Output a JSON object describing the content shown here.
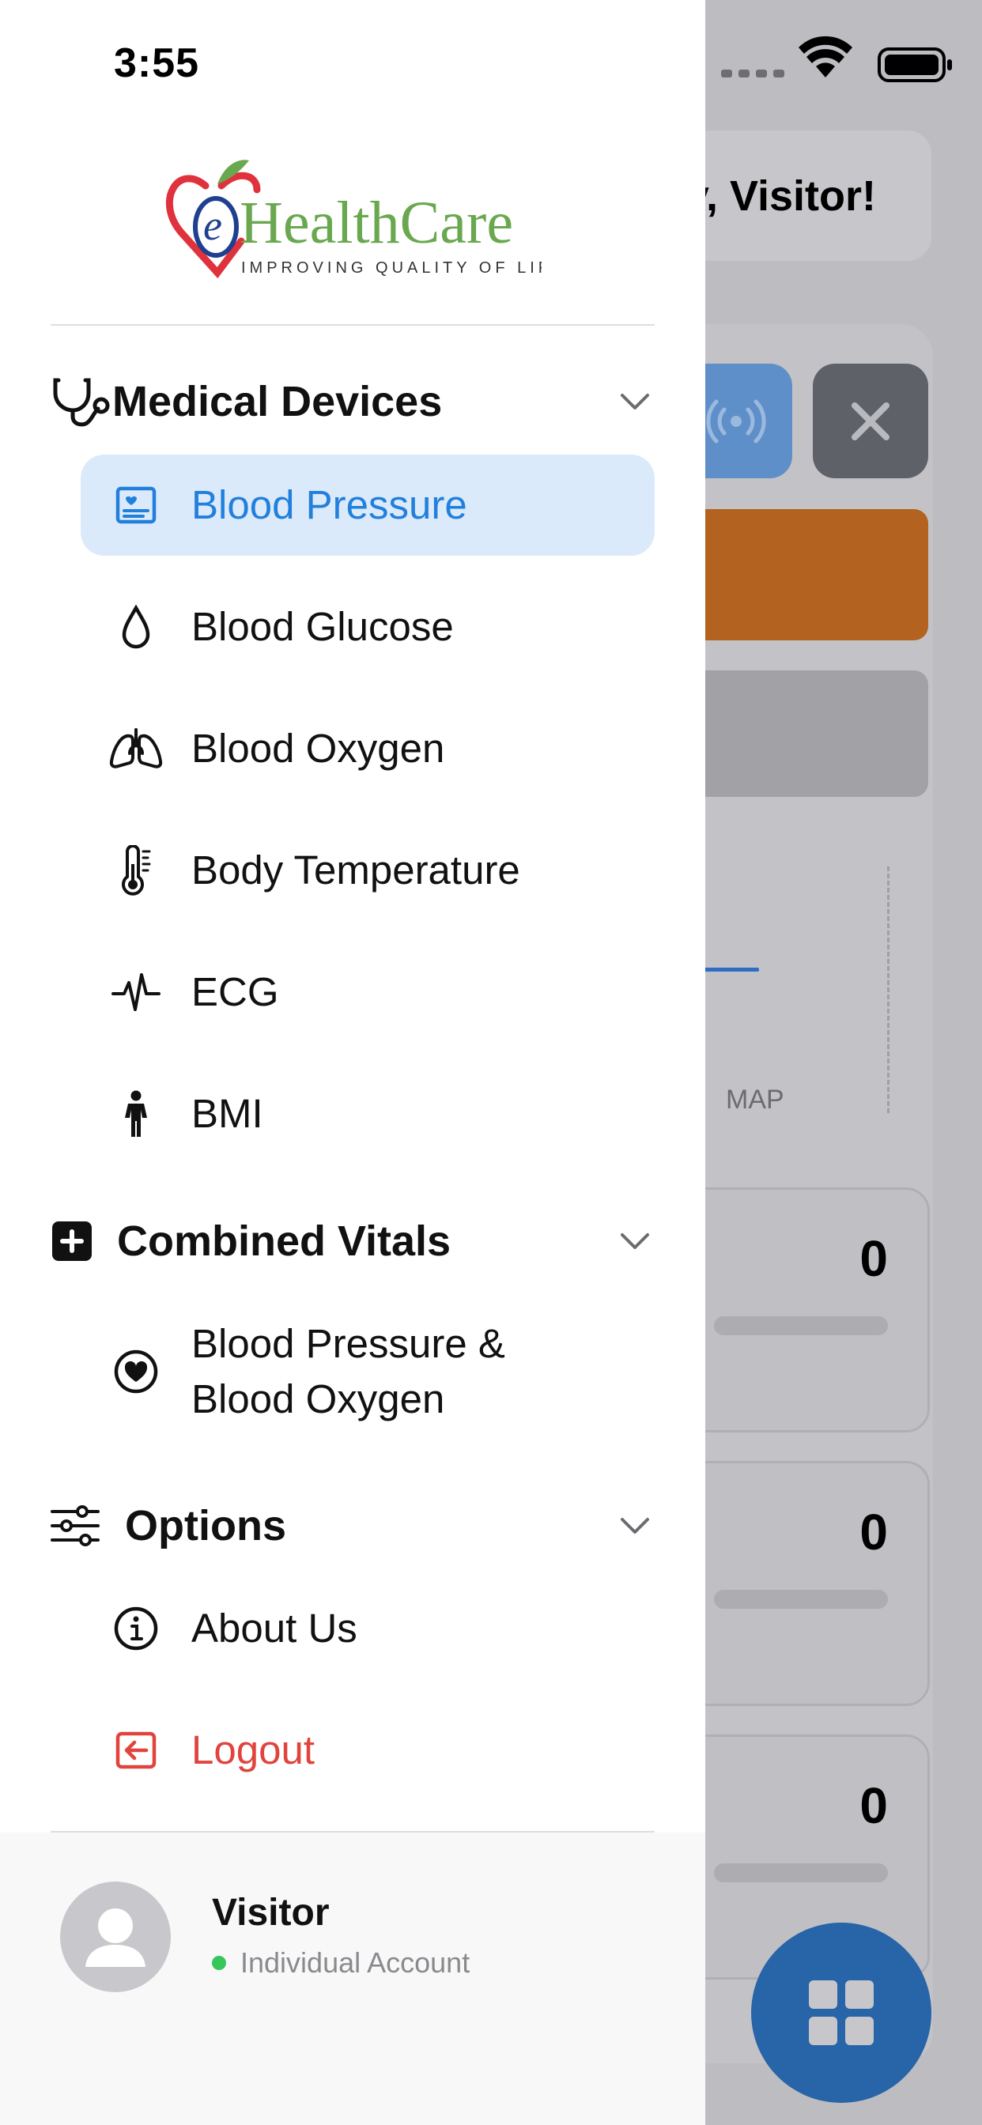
{
  "status_bar": {
    "time": "3:55"
  },
  "brand": {
    "logo_text": "HealthCare",
    "logo_prefix": "e",
    "tagline": "IMPROVING QUALITY OF LIFE"
  },
  "background": {
    "greeting": "day, Visitor!",
    "chart_label": "MAP",
    "card_values": [
      "0",
      "0",
      "0"
    ]
  },
  "sections": [
    {
      "title": "Medical Devices",
      "icon": "stethoscope-icon",
      "items": [
        {
          "label": "Blood Pressure",
          "icon": "patient-card-icon",
          "active": true
        },
        {
          "label": "Blood Glucose",
          "icon": "drop-icon"
        },
        {
          "label": "Blood Oxygen",
          "icon": "lungs-icon"
        },
        {
          "label": "Body Temperature",
          "icon": "thermometer-icon"
        },
        {
          "label": "ECG",
          "icon": "pulse-icon"
        },
        {
          "label": "BMI",
          "icon": "person-icon"
        }
      ]
    },
    {
      "title": "Combined Vitals",
      "icon": "plus-square-icon",
      "items": [
        {
          "label_line1": "Blood Pressure &",
          "label_line2": "Blood Oxygen",
          "icon": "heart-circle-icon"
        }
      ]
    },
    {
      "title": "Options",
      "icon": "sliders-icon",
      "items": [
        {
          "label": "About Us",
          "icon": "info-icon"
        },
        {
          "label": "Logout",
          "icon": "logout-icon"
        }
      ]
    }
  ],
  "user": {
    "name": "Visitor",
    "account_type": "Individual Account"
  },
  "colors": {
    "accent": "#2280dc",
    "active_bg": "#dbeafb",
    "logout": "#e0443c",
    "online": "#35c759"
  }
}
